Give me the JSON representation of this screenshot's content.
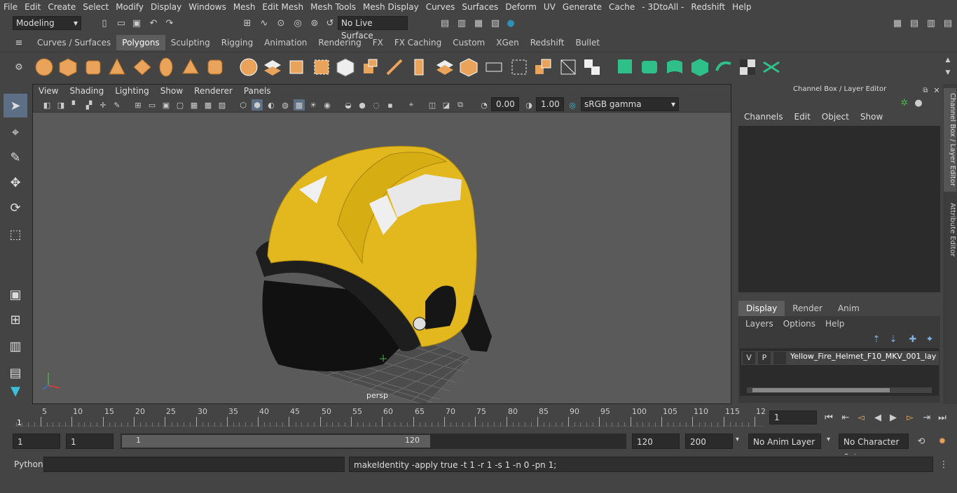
{
  "menu": [
    "File",
    "Edit",
    "Create",
    "Select",
    "Modify",
    "Display",
    "Windows",
    "Mesh",
    "Edit Mesh",
    "Mesh Tools",
    "Mesh Display",
    "Curves",
    "Surfaces",
    "Deform",
    "UV",
    "Generate",
    "Cache",
    "- 3DtoAll -",
    "Redshift",
    "Help"
  ],
  "status": {
    "mode": "Modeling",
    "live_surface": "No Live Surface"
  },
  "shelf_tabs": [
    "Curves / Surfaces",
    "Polygons",
    "Sculpting",
    "Rigging",
    "Animation",
    "Rendering",
    "FX",
    "FX Caching",
    "Custom",
    "XGen",
    "Redshift",
    "Bullet"
  ],
  "shelf_active": "Polygons",
  "viewport": {
    "menu": [
      "View",
      "Shading",
      "Lighting",
      "Show",
      "Renderer",
      "Panels"
    ],
    "exposure": "0.00",
    "gamma": "1.00",
    "colorspace": "sRGB gamma",
    "camera_label": "persp"
  },
  "channel_box": {
    "title": "Channel Box / Layer Editor",
    "menu": [
      "Channels",
      "Edit",
      "Object",
      "Show"
    ]
  },
  "layer_editor": {
    "tabs": [
      "Display",
      "Render",
      "Anim"
    ],
    "active_tab": "Display",
    "menu": [
      "Layers",
      "Options",
      "Help"
    ],
    "layer": {
      "v": "V",
      "p": "P",
      "name": "Yellow_Fire_Helmet_F10_MKV_001_lay"
    }
  },
  "side_tabs": [
    "Channel Box / Layer Editor",
    "Attribute Editor"
  ],
  "timeline": {
    "ticks": [
      "5",
      "10",
      "15",
      "20",
      "25",
      "30",
      "35",
      "40",
      "45",
      "50",
      "55",
      "60",
      "65",
      "70",
      "75",
      "80",
      "85",
      "90",
      "95",
      "100",
      "105",
      "110",
      "115",
      "12"
    ],
    "start_marker": "1",
    "current_frame": "1"
  },
  "range": {
    "start": "1",
    "anim_start": "1",
    "slider_start": "1",
    "slider_end": "120",
    "end": "120",
    "anim_end": "200",
    "anim_layer": "No Anim Layer",
    "char_set": "No Character Set"
  },
  "cmd": {
    "lang": "Python",
    "result": "makeIdentity -apply true -t 1 -r 1 -s 1 -n 0 -pn 1;"
  },
  "colors": {
    "helmet": "#e2b81e",
    "visor": "#1a1a1a",
    "accent": "#2f8fb5"
  }
}
